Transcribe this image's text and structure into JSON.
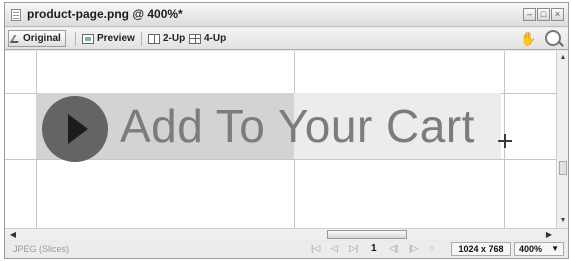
{
  "window": {
    "title": "product-page.png @ 400%*"
  },
  "toolbar": {
    "tabs": [
      {
        "label": "Original",
        "icon": "pencil-icon"
      },
      {
        "label": "Preview",
        "icon": "preview-icon"
      },
      {
        "label": "2-Up",
        "icon": "two-up-icon"
      },
      {
        "label": "4-Up",
        "icon": "four-up-icon"
      }
    ],
    "active_tab": "Original",
    "tools": [
      "hand-icon",
      "zoom-icon"
    ]
  },
  "canvas": {
    "button_text": "Add To Your Cart",
    "button_icon": "play-icon",
    "cursor": "crosshair-icon"
  },
  "statusbar": {
    "format": "JPEG (Slices)",
    "frame_controls": [
      "first-frame-icon",
      "prev-frame-icon",
      "last-frame-icon",
      "play-frame-icon",
      "next-frame-icon",
      "loop-icon"
    ],
    "frame_number": "1",
    "dimensions": "1024 x 768",
    "zoom": "400%"
  }
}
